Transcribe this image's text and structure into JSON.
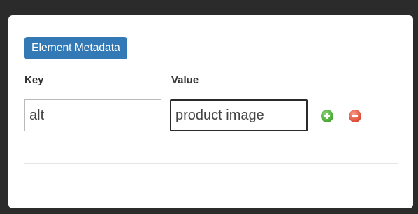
{
  "panel": {
    "badge": "Element Metadata",
    "columns": {
      "key_label": "Key",
      "value_label": "Value"
    },
    "row": {
      "key_value": "alt",
      "value_value": "product image"
    },
    "buttons": {
      "add_icon": "plus-circle-icon",
      "remove_icon": "minus-circle-icon"
    },
    "colors": {
      "badge": "#3379b5",
      "add": "#4fae3a",
      "remove": "#e2543f"
    }
  }
}
